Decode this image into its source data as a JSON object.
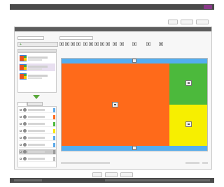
{
  "top_bar": {
    "user_info": "",
    "logout_label": ""
  },
  "breadcrumb": "",
  "header_actions": [
    "",
    "",
    ""
  ],
  "panel": {
    "title": "",
    "field_labels": [
      "",
      ""
    ],
    "add_layout_label": ""
  },
  "layouts": [
    {
      "thumb_colors": [
        "#e8501e",
        "#f6c400",
        "#46a83e",
        "#3a7bd5"
      ]
    },
    {
      "thumb_colors": [
        "#e8501e",
        "#f6c400",
        "#46a83e",
        "#3a7bd5"
      ],
      "selected": true
    },
    {
      "thumb_colors": [
        "#e8501e",
        "#f6c400",
        "#46a83e",
        "#3a7bd5"
      ]
    }
  ],
  "tabs": [
    "",
    ""
  ],
  "zones": [
    {
      "swatch": "#5aa8e8"
    },
    {
      "swatch": "#ff6a1a"
    },
    {
      "swatch": "#4cb93c"
    },
    {
      "swatch": "#f7e400"
    },
    {
      "swatch": "#5aa8e8"
    },
    {
      "swatch": "#5aa8e8"
    },
    {
      "swatch": "#9a9a9a",
      "selected": true
    },
    {
      "swatch": "#bbbbbb"
    }
  ],
  "canvas": {
    "colors": {
      "band": "#54aef0",
      "main": "#ff6a1a",
      "side_top": "#4cb93c",
      "side_bottom": "#f7ef00"
    }
  },
  "footer_actions": [
    "",
    "",
    ""
  ],
  "colors": {
    "chrome": "#4a4a4a",
    "accent": "#8a3a8a",
    "add_arrow": "#5aa83a"
  }
}
